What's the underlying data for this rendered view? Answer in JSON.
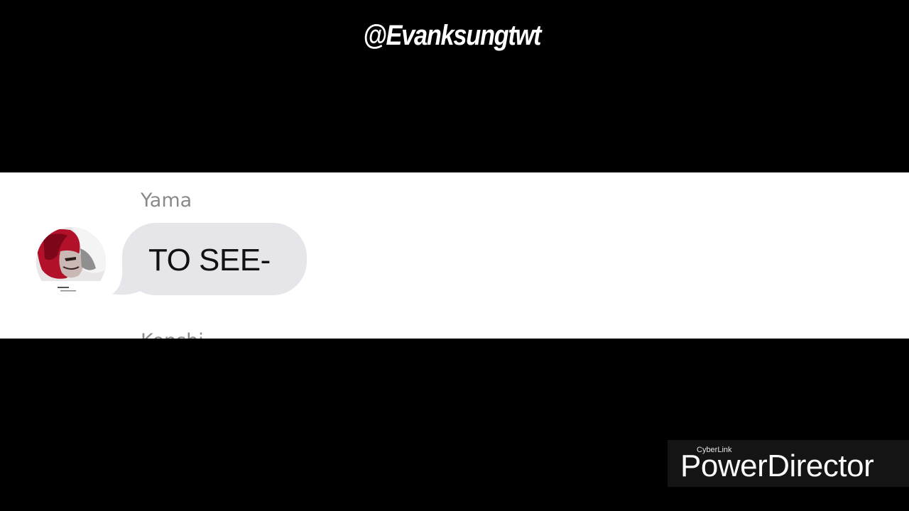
{
  "overlay": {
    "handle": "@Evanksungtwt"
  },
  "chat": {
    "message": {
      "sender": "Yama",
      "text": "TO SEE-",
      "avatar_icon": "profile-avatar-icon"
    },
    "next_message": {
      "sender_partial": "Kenshi"
    },
    "colors": {
      "background": "#ffffff",
      "bubble": "#e5e5ea",
      "sender_name": "#8a8a8a",
      "message_text": "#111111"
    }
  },
  "watermark": {
    "brand": "CyberLink",
    "product": "PowerDirector"
  }
}
